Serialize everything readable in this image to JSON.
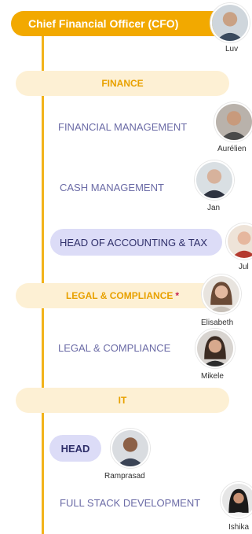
{
  "top": {
    "title": "Chief Financial Officer (CFO)",
    "person": "Luv"
  },
  "sections": {
    "finance": "FINANCE",
    "legal": "LEGAL & COMPLIANCE",
    "legal_mark": "*",
    "it": "IT"
  },
  "roles": {
    "financial_management": "FINANCIAL MANAGEMENT",
    "cash_management": "CASH MANAGEMENT",
    "head_accounting_tax": "HEAD OF ACCOUNTING & TAX",
    "legal_compliance": "LEGAL & COMPLIANCE",
    "it_head": "HEAD",
    "full_stack": "FULL STACK DEVELOPMENT"
  },
  "people": {
    "aurelien": "Aurélien",
    "jan": "Jan",
    "jul": "Jul",
    "elisabeth": "Elisabeth",
    "mikele": "Mikele",
    "ramprasad": "Ramprasad",
    "ishika": "Ishika"
  },
  "colors": {
    "accent": "#f2a900",
    "section_bg": "#fdf0d4",
    "role_text": "#6b6ba6",
    "pill_bg": "#dcdcf7"
  }
}
